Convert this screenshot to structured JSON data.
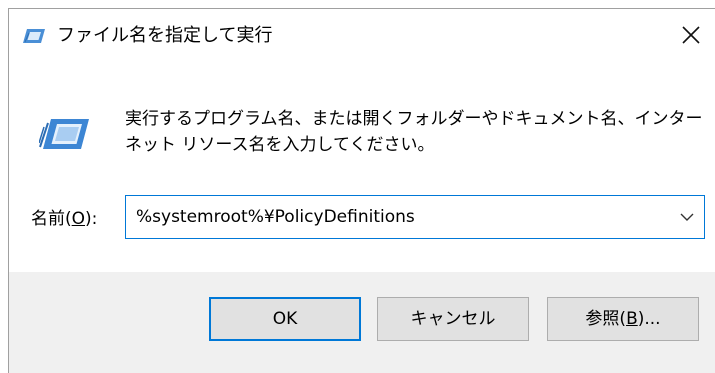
{
  "window": {
    "title": "ファイル名を指定して実行",
    "close_label": "✕"
  },
  "main": {
    "description_line1": "実行するプログラム名、または開くフォルダーやドキュメント名、インター",
    "description_line2": "ネット リソース名を入力してください。",
    "name_label_prefix": "名前(",
    "name_label_accel": "O",
    "name_label_suffix": "):",
    "input_value": "%systemroot%¥PolicyDefinitions"
  },
  "buttons": {
    "ok_label": "OK",
    "cancel_label": "キャンセル",
    "browse_prefix": "参照(",
    "browse_accel": "B",
    "browse_suffix": ")..."
  },
  "icons": {
    "title_icon": "run-dialog-icon",
    "main_icon": "run-dialog-icon",
    "close_icon": "close-icon",
    "dropdown_icon": "chevron-down-icon"
  },
  "colors": {
    "accent": "#0078d7",
    "footer_bg": "#f0f0f0",
    "button_bg": "#e1e1e1"
  }
}
